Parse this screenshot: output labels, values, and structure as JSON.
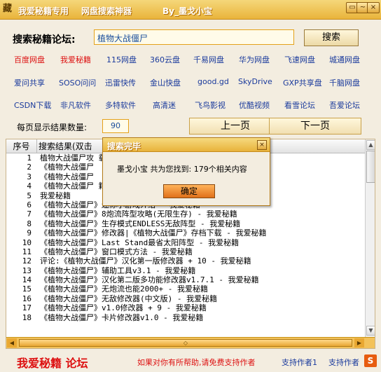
{
  "titlebar": {
    "logo": "藏",
    "title_1": "我爱秘籍专用",
    "title_2": "网盘搜索神器",
    "title_3": "By_墨戈小宝",
    "min": "▭",
    "max": "~",
    "close": "×"
  },
  "search": {
    "label": "搜索秘籍论坛:",
    "value": "植物大战僵尸",
    "button": "搜索"
  },
  "links": [
    [
      "百度网盘",
      "我爱秘籍",
      "115网盘",
      "360云盘",
      "千易网盘",
      "华为网盘",
      "飞速网盘",
      "城通网盘"
    ],
    [
      "爱问共享",
      "SOSO问问",
      "迅雷快传",
      "金山快盘",
      "good.gd",
      "SkyDrive",
      "GXP共享盘",
      "千脑网盘"
    ],
    [
      "CSDN下载",
      "非凡软件",
      "多特软件",
      "高清迷",
      "飞鸟影视",
      "优酷视频",
      "看雪论坛",
      "吾爱论坛"
    ]
  ],
  "pagination": {
    "per_page_label": "每页显示结果数量:",
    "per_page_value": "90",
    "prev": "上一页",
    "next": "下一页"
  },
  "results": {
    "col_no": "序号",
    "col_title": "搜索结果(双击",
    "rows": [
      {
        "no": "1",
        "text": "植物大战僵尸攻                                                      载专区 - 我爱..."
      },
      {
        "no": "2",
        "text": "《植物大战僵尸"
      },
      {
        "no": "3",
        "text": "《植物大战僵尸"
      },
      {
        "no": "4",
        "text": "《植物大战僵尸                                                  籍"
      },
      {
        "no": "5",
        "text": "我爱秘籍"
      },
      {
        "no": "6",
        "text": "《植物大战僵尸》迷你小游戏介绍 - 我爱秘籍"
      },
      {
        "no": "7",
        "text": "《植物大战僵尸》8炮流阵型攻略(无限生存) - 我爱秘籍"
      },
      {
        "no": "8",
        "text": "《植物大战僵尸》生存模式ENDLESS无敌阵型 - 我爱秘籍"
      },
      {
        "no": "9",
        "text": "《植物大战僵尸》修改器|《植物大战僵尸》存档下载 - 我爱秘籍"
      },
      {
        "no": "10",
        "text": "《植物大战僵尸》Last Stand最省太阳阵型 - 我爱秘籍"
      },
      {
        "no": "11",
        "text": "《植物大战僵尸》窗口模式方法 - 我爱秘籍"
      },
      {
        "no": "12",
        "text": "评论:《植物大战僵尸》汉化第一版修改器 + 10 - 我爱秘籍"
      },
      {
        "no": "13",
        "text": "《植物大战僵尸》辅助工具v3.1 - 我爱秘籍"
      },
      {
        "no": "14",
        "text": "《植物大战僵尸》汉化第二版多功能修改器v1.7.1 - 我爱秘籍"
      },
      {
        "no": "15",
        "text": "《植物大战僵尸》无炮流也能2000+ - 我爱秘籍"
      },
      {
        "no": "16",
        "text": "《植物大战僵尸》无敌修改器(中文版) - 我爱秘籍"
      },
      {
        "no": "17",
        "text": "《植物大战僵尸》v1.0修改器 + 9 - 我爱秘籍"
      },
      {
        "no": "18",
        "text": "《植物大战僵尸》卡片修改器v1.0 - 我爱秘籍"
      }
    ]
  },
  "scroll": {
    "up": "▲",
    "down": "▼",
    "left": "◀",
    "right": "▶",
    "grip": "◇"
  },
  "footer": {
    "logo": "我爱秘籍 论坛",
    "message": "如果对你有所帮助,请免费支持作者",
    "support_1": "支持作者1",
    "support_2": "支持作者",
    "icon": "S"
  },
  "dialog": {
    "title": "搜索完毕",
    "close": "×",
    "message": "墨戈小宝 共为您找到: 179个相关内容",
    "ok": "确定"
  }
}
